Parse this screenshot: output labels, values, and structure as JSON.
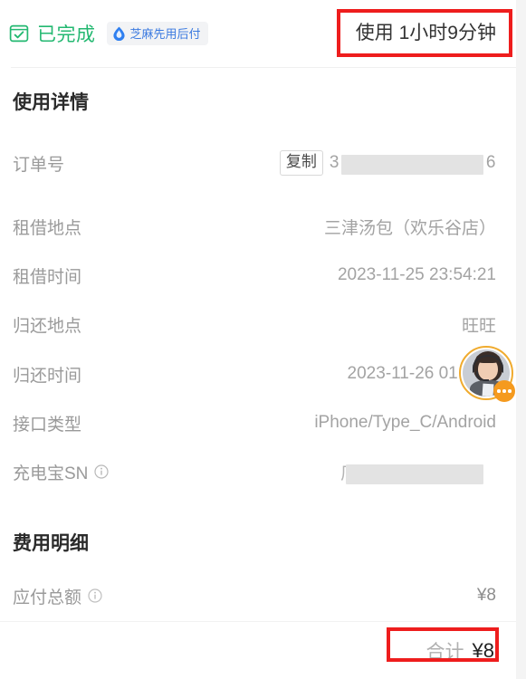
{
  "header": {
    "status_icon": "checkbox-check-icon",
    "status_label": "已完成",
    "badge_icon": "water-drop-icon",
    "badge_label": "芝麻先用后付",
    "duration_label": "使用 1小时9分钟",
    "status_color": "#23b871",
    "badge_color": "#3b7ae0"
  },
  "usage_section": {
    "title": "使用详情",
    "rows": [
      {
        "label": "订单号",
        "copy_label": "复制",
        "value_prefix": "3",
        "value_suffix": "6",
        "redacted": true
      },
      {
        "label": "租借地点",
        "value": "三津汤包（欢乐谷店）"
      },
      {
        "label": "租借时间",
        "value": "2023-11-25 23:54:21"
      },
      {
        "label": "归还地点",
        "value": "旺旺"
      },
      {
        "label": "归还时间",
        "value": "2023-11-26 01:02:4"
      },
      {
        "label": "接口类型",
        "value": "iPhone/Type_C/Android"
      },
      {
        "label": "充电宝SN",
        "info_icon": "info-circle-icon",
        "value_prefix": "厂",
        "redacted": true
      }
    ]
  },
  "fee_section": {
    "title": "费用明细",
    "rows": [
      {
        "label": "应付总额",
        "info_icon": "info-circle-icon",
        "value": "¥8"
      }
    ]
  },
  "total_bar": {
    "label": "合计",
    "amount": "¥8"
  },
  "customer_service": {
    "name": "customer-service-avatar",
    "badge_icon": "chat-dots-icon",
    "ring_color": "#f0ab2e",
    "badge_color": "#f59a1e"
  },
  "annotations": {
    "color": "#ee1d1d",
    "boxes": [
      {
        "name": "duration-highlight",
        "target": "使用 1小时9分钟"
      },
      {
        "name": "total-highlight",
        "target": "合计 ¥8"
      }
    ]
  }
}
